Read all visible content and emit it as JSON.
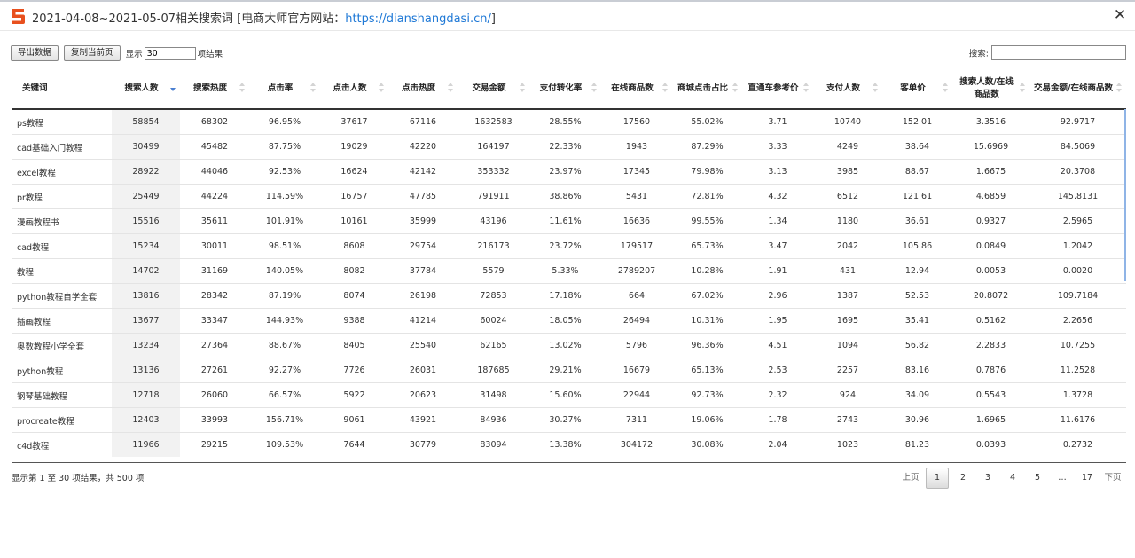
{
  "window": {
    "title_prefix": "2021-04-08~2021-05-07相关搜索词 [电商大师官方网站：",
    "title_link": "https://dianshangdasi.cn/",
    "title_suffix": "]",
    "close_glyph": "✕",
    "logo_icon": "dianshangdasi-logo",
    "logo_color": "#e8501e"
  },
  "toolbar": {
    "export_label": "导出数据",
    "copy_label": "复制当前页",
    "show_label": "显示",
    "length_value": "30",
    "items_label": "项结果"
  },
  "search": {
    "label": "搜索:",
    "value": ""
  },
  "table": {
    "sorted_column": "搜索人数",
    "headers": [
      "关键词",
      "搜索人数",
      "搜索热度",
      "点击率",
      "点击人数",
      "点击热度",
      "交易金额",
      "支付转化率",
      "在线商品数",
      "商城点击占比",
      "直通车参考价",
      "支付人数",
      "客单价",
      "搜索人数/在线商品数",
      "交易金额/在线商品数"
    ],
    "rows": [
      [
        "ps教程",
        "58854",
        "68302",
        "96.95%",
        "37617",
        "67116",
        "1632583",
        "28.55%",
        "17560",
        "55.02%",
        "3.71",
        "10740",
        "152.01",
        "3.3516",
        "92.9717"
      ],
      [
        "cad基础入门教程",
        "30499",
        "45482",
        "87.75%",
        "19029",
        "42220",
        "164197",
        "22.33%",
        "1943",
        "87.29%",
        "3.33",
        "4249",
        "38.64",
        "15.6969",
        "84.5069"
      ],
      [
        "excel教程",
        "28922",
        "44046",
        "92.53%",
        "16624",
        "42142",
        "353332",
        "23.97%",
        "17345",
        "79.98%",
        "3.13",
        "3985",
        "88.67",
        "1.6675",
        "20.3708"
      ],
      [
        "pr教程",
        "25449",
        "44224",
        "114.59%",
        "16757",
        "47785",
        "791911",
        "38.86%",
        "5431",
        "72.81%",
        "4.32",
        "6512",
        "121.61",
        "4.6859",
        "145.8131"
      ],
      [
        "漫画教程书",
        "15516",
        "35611",
        "101.91%",
        "10161",
        "35999",
        "43196",
        "11.61%",
        "16636",
        "99.55%",
        "1.34",
        "1180",
        "36.61",
        "0.9327",
        "2.5965"
      ],
      [
        "cad教程",
        "15234",
        "30011",
        "98.51%",
        "8608",
        "29754",
        "216173",
        "23.72%",
        "179517",
        "65.73%",
        "3.47",
        "2042",
        "105.86",
        "0.0849",
        "1.2042"
      ],
      [
        "教程",
        "14702",
        "31169",
        "140.05%",
        "8082",
        "37784",
        "5579",
        "5.33%",
        "2789207",
        "10.28%",
        "1.91",
        "431",
        "12.94",
        "0.0053",
        "0.0020"
      ],
      [
        "python教程自学全套",
        "13816",
        "28342",
        "87.19%",
        "8074",
        "26198",
        "72853",
        "17.18%",
        "664",
        "67.02%",
        "2.96",
        "1387",
        "52.53",
        "20.8072",
        "109.7184"
      ],
      [
        "插画教程",
        "13677",
        "33347",
        "144.93%",
        "9388",
        "41214",
        "60024",
        "18.05%",
        "26494",
        "10.31%",
        "1.95",
        "1695",
        "35.41",
        "0.5162",
        "2.2656"
      ],
      [
        "奥数教程小学全套",
        "13234",
        "27364",
        "88.67%",
        "8405",
        "25540",
        "62165",
        "13.02%",
        "5796",
        "96.36%",
        "4.51",
        "1094",
        "56.82",
        "2.2833",
        "10.7255"
      ],
      [
        "python教程",
        "13136",
        "27261",
        "92.27%",
        "7726",
        "26031",
        "187685",
        "29.21%",
        "16679",
        "65.13%",
        "2.53",
        "2257",
        "83.16",
        "0.7876",
        "11.2528"
      ],
      [
        "钢琴基础教程",
        "12718",
        "26060",
        "66.57%",
        "5922",
        "20623",
        "31498",
        "15.60%",
        "22944",
        "92.73%",
        "2.32",
        "924",
        "34.09",
        "0.5543",
        "1.3728"
      ],
      [
        "procreate教程",
        "12403",
        "33993",
        "156.71%",
        "9061",
        "43921",
        "84936",
        "30.27%",
        "7311",
        "19.06%",
        "1.78",
        "2743",
        "30.96",
        "1.6965",
        "11.6176"
      ],
      [
        "c4d教程",
        "11966",
        "29215",
        "109.53%",
        "7644",
        "30779",
        "83094",
        "13.38%",
        "304172",
        "30.08%",
        "2.04",
        "1023",
        "81.23",
        "0.0393",
        "0.2732"
      ]
    ]
  },
  "footer": {
    "info": "显示第 1 至 30 项结果，共 500 项",
    "prev_label": "上页",
    "next_label": "下页",
    "pages": [
      "1",
      "2",
      "3",
      "4",
      "5",
      "…",
      "17"
    ],
    "current_page": "1"
  }
}
